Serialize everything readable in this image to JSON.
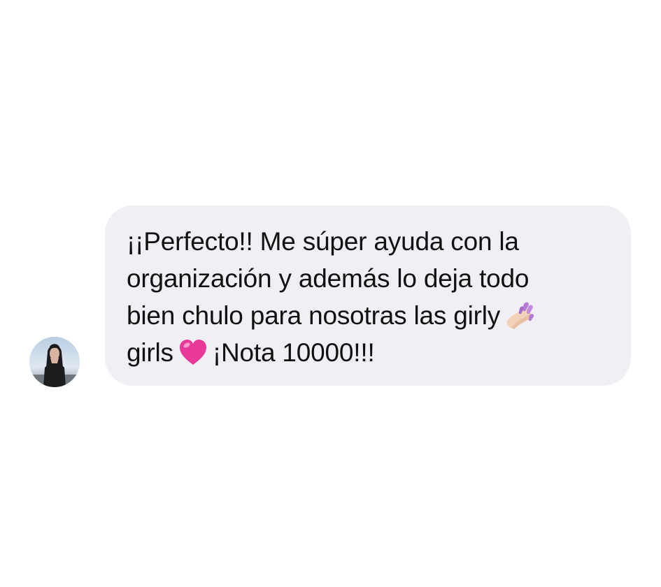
{
  "conversation": {
    "message": {
      "line_1": "¡¡Perfecto!! Me súper ayuda con la",
      "line_2": "organización y además lo deja todo",
      "line_3": "bien chulo para nosotras las girly",
      "line_4_start": "girls",
      "line_4_end": "¡Nota 10000!!!",
      "emojis": [
        "nail-polish-icon",
        "pink-heart-icon"
      ]
    },
    "sender_avatar": "avatar-photo"
  },
  "colors": {
    "bubble_background": "#efeff4",
    "text": "#111111",
    "page_background": "#ffffff"
  }
}
